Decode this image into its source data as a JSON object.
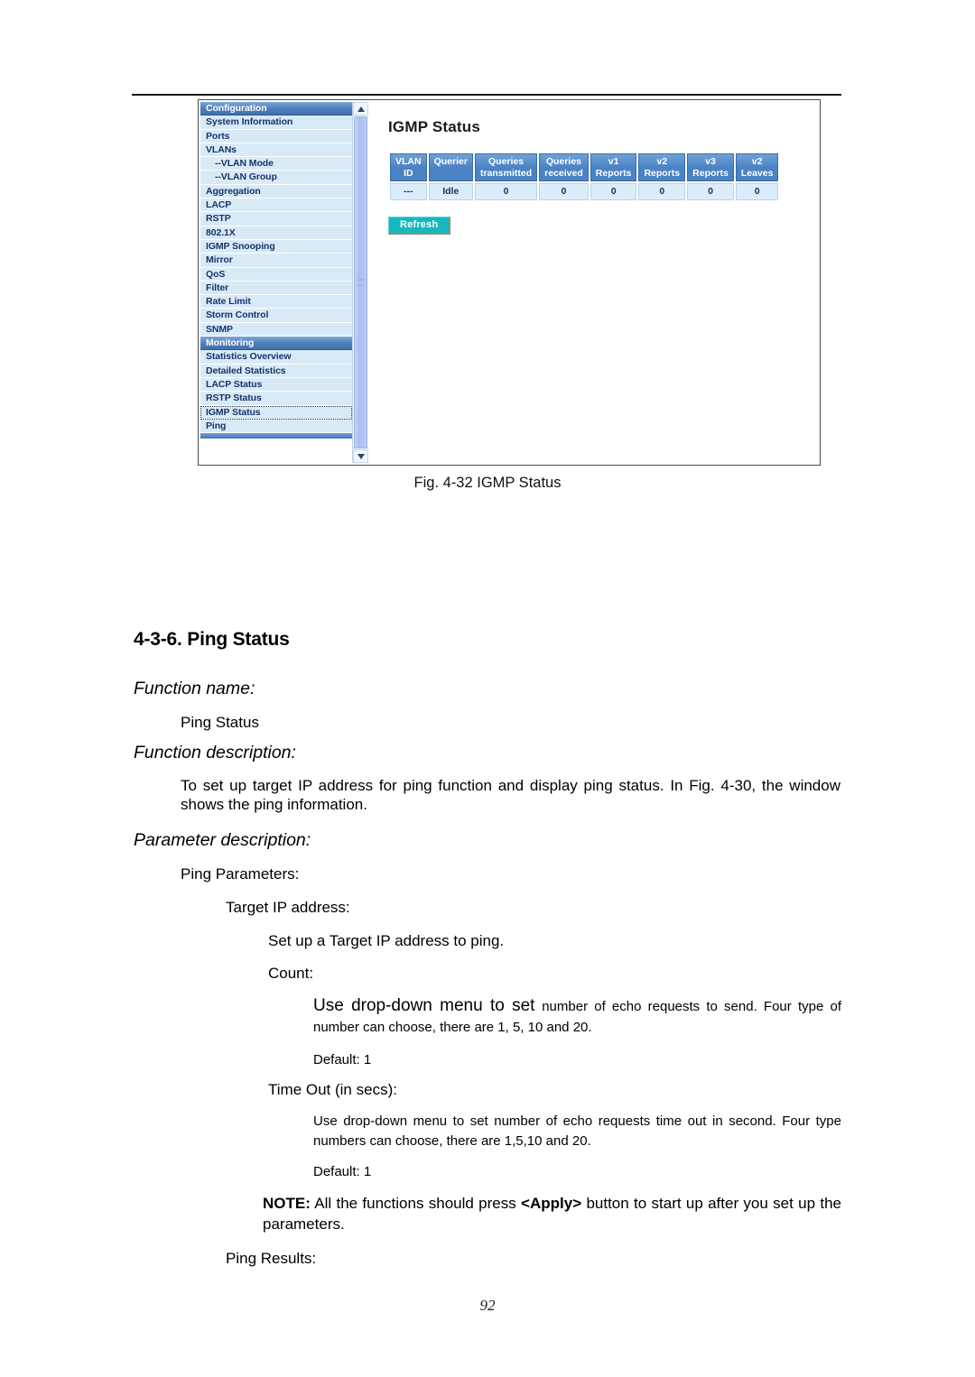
{
  "figure": {
    "caption": "Fig. 4-32 IGMP Status",
    "app": {
      "sidebar": {
        "items": [
          {
            "label": "Configuration",
            "type": "group"
          },
          {
            "label": "System Information",
            "type": "item"
          },
          {
            "label": "Ports",
            "type": "item"
          },
          {
            "label": "VLANs",
            "type": "item"
          },
          {
            "label": "--VLAN Mode",
            "type": "sub"
          },
          {
            "label": "--VLAN Group",
            "type": "sub"
          },
          {
            "label": "Aggregation",
            "type": "item"
          },
          {
            "label": "LACP",
            "type": "item"
          },
          {
            "label": "RSTP",
            "type": "item"
          },
          {
            "label": "802.1X",
            "type": "item"
          },
          {
            "label": "IGMP Snooping",
            "type": "item"
          },
          {
            "label": "Mirror",
            "type": "item"
          },
          {
            "label": "QoS",
            "type": "item"
          },
          {
            "label": "Filter",
            "type": "item"
          },
          {
            "label": "Rate Limit",
            "type": "item"
          },
          {
            "label": "Storm Control",
            "type": "item"
          },
          {
            "label": "SNMP",
            "type": "item"
          },
          {
            "label": "Monitoring",
            "type": "group"
          },
          {
            "label": "Statistics Overview",
            "type": "item"
          },
          {
            "label": "Detailed Statistics",
            "type": "item"
          },
          {
            "label": "LACP Status",
            "type": "item"
          },
          {
            "label": "RSTP Status",
            "type": "item"
          },
          {
            "label": "IGMP Status",
            "type": "item",
            "focused": true
          },
          {
            "label": "Ping",
            "type": "item"
          }
        ]
      },
      "page_title": "IGMP Status",
      "table": {
        "headers": [
          "VLAN ID",
          "Querier",
          "Queries transmitted",
          "Queries received",
          "v1 Reports",
          "v2 Reports",
          "v3 Reports",
          "v2 Leaves"
        ],
        "rows": [
          [
            "---",
            "Idle",
            "0",
            "0",
            "0",
            "0",
            "0",
            "0"
          ]
        ]
      },
      "refresh_label": "Refresh",
      "colors": {
        "header_blue": "#4a81c2",
        "cell_blue": "#ddecfa",
        "refresh_teal": "#16b8bd",
        "menu_blue": "#d9eaf7"
      }
    }
  },
  "doc": {
    "section_heading": "4-3-6. Ping Status",
    "function_name_label": "Function name:",
    "function_name_value": "Ping Status",
    "function_description_label": "Function description:",
    "function_description_text": "To set up target IP address for ping function and display ping status. In Fig. 4-30, the window shows the ping information.",
    "parameter_description_label": "Parameter description:",
    "ping_parameters_label": "Ping Parameters:",
    "target_ip_label": "Target IP address:",
    "target_ip_text": "Set up a Target IP address to ping.",
    "count_label": "Count:",
    "count_text_lead": "Use drop-down menu to set",
    "count_text_rest": "number of echo requests to send. Four type of number can choose, there are 1, 5, 10 and 20.",
    "count_default": "Default: 1",
    "timeout_label": "Time Out (in secs):",
    "timeout_text": "Use drop-down menu to set number of echo requests time out in second. Four type numbers can choose, there are 1,5,10 and 20.",
    "timeout_default": "Default: 1",
    "note_prefix": "NOTE:",
    "note_text_a": "All the functions should press",
    "note_emphasis": "<Apply>",
    "note_text_b": "button to start up after you set up the parameters.",
    "ping_results_label": "Ping Results:",
    "page_number": "92"
  }
}
